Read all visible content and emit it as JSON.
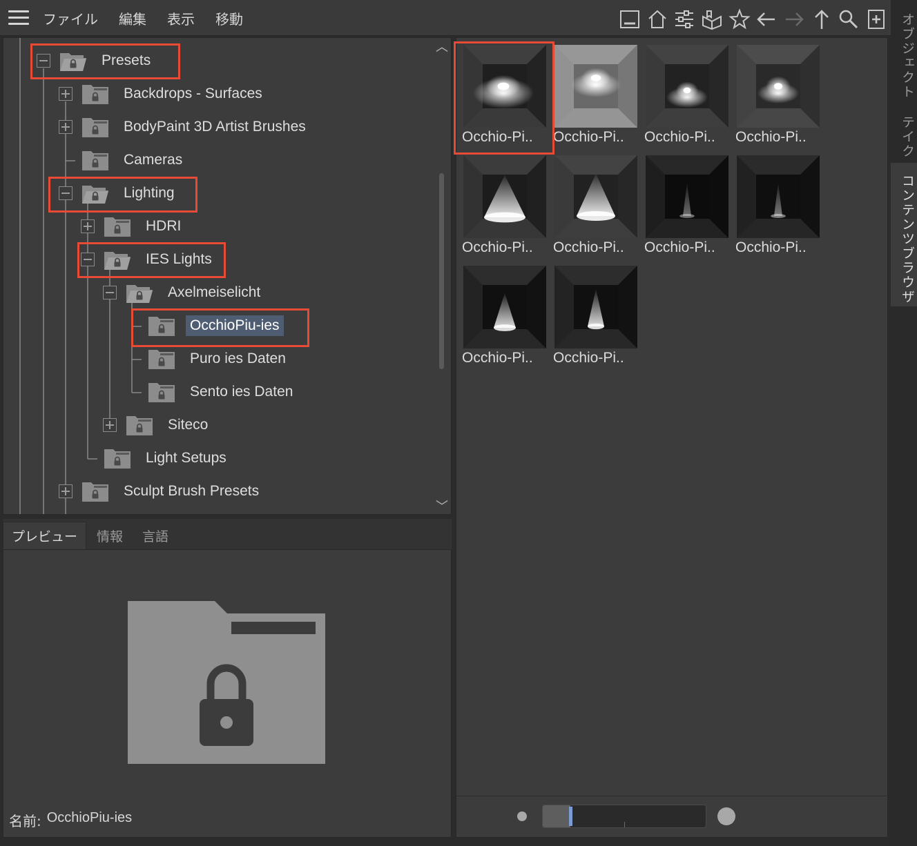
{
  "menu": {
    "items": [
      "ファイル",
      "編集",
      "表示",
      "移動"
    ]
  },
  "toolbar": {
    "icons": [
      "panel-icon",
      "home-icon",
      "settings-sliders-icon",
      "catalog-book-icon",
      "star-icon",
      "back-arrow-icon",
      "forward-arrow-icon",
      "up-arrow-icon",
      "search-icon",
      "new-item-icon"
    ]
  },
  "tree": {
    "items": [
      {
        "label": "Presets",
        "level": 0,
        "expander": "minus",
        "open": true
      },
      {
        "label": "Backdrops - Surfaces",
        "level": 1,
        "expander": "plus"
      },
      {
        "label": "BodyPaint 3D Artist Brushes",
        "level": 1,
        "expander": "plus"
      },
      {
        "label": "Cameras",
        "level": 1,
        "expander": "none"
      },
      {
        "label": "Lighting",
        "level": 1,
        "expander": "minus",
        "open": true
      },
      {
        "label": "HDRI",
        "level": 2,
        "expander": "plus"
      },
      {
        "label": "IES Lights",
        "level": 2,
        "expander": "minus",
        "open": true
      },
      {
        "label": "Axelmeiselicht",
        "level": 3,
        "expander": "minus",
        "open": true
      },
      {
        "label": "OcchioPiu-ies",
        "level": 4,
        "expander": "none",
        "selected": true
      },
      {
        "label": "Puro ies Daten",
        "level": 4,
        "expander": "none"
      },
      {
        "label": "Sento ies Daten",
        "level": 4,
        "expander": "none"
      },
      {
        "label": "Siteco",
        "level": 3,
        "expander": "plus"
      },
      {
        "label": "Light Setups",
        "level": 2,
        "expander": "none"
      },
      {
        "label": "Sculpt Brush Presets",
        "level": 1,
        "expander": "plus"
      }
    ]
  },
  "preview": {
    "tabs": [
      "プレビュー",
      "情報",
      "言語"
    ],
    "active_tab": "プレビュー",
    "name_label": "名前:",
    "name_value": "OcchioPiu-ies"
  },
  "thumbnails": {
    "items": [
      {
        "caption": "Occhio-Pi..",
        "style": "spot-wide"
      },
      {
        "caption": "Occhio-Pi..",
        "style": "spot-top"
      },
      {
        "caption": "Occhio-Pi..",
        "style": "spot-small"
      },
      {
        "caption": "Occhio-Pi..",
        "style": "spot-cross"
      },
      {
        "caption": "Occhio-Pi..",
        "style": "cone-wide"
      },
      {
        "caption": "Occhio-Pi..",
        "style": "cone-wide-2"
      },
      {
        "caption": "Occhio-Pi..",
        "style": "dim-beam"
      },
      {
        "caption": "Occhio-Pi..",
        "style": "dim-beam-2"
      },
      {
        "caption": "Occhio-Pi..",
        "style": "cone-narrow"
      },
      {
        "caption": "Occhio-Pi..",
        "style": "cone-narrow-2"
      }
    ],
    "zoom_level": 0.17
  },
  "side_tabs": {
    "items": [
      "オブジェクト",
      "テイク",
      "コンテンツブラウザ"
    ],
    "active": "コンテンツブラウザ"
  },
  "colors": {
    "highlight": "#e84b35",
    "selection": "#4f5d73",
    "slider_marker": "#7c9bd4"
  }
}
